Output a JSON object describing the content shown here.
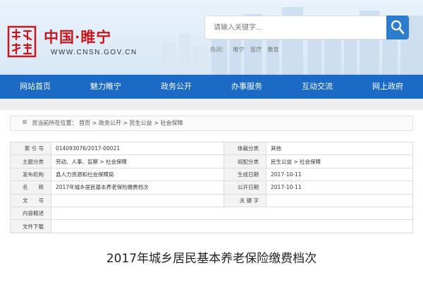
{
  "header": {
    "seal_text": "睢州宁陵",
    "site_name": "中国",
    "separator": "·",
    "site_name2": "睢宁",
    "domain": "WWW.CNSN.GOV.CN"
  },
  "search": {
    "placeholder": "请输入关键字...",
    "icon": "search-icon",
    "hot_label": "热词：",
    "hot_words": [
      "睢宁",
      "医疗",
      "教育"
    ]
  },
  "nav": {
    "items": [
      "网站首页",
      "魅力睢宁",
      "政务公开",
      "办事服务",
      "互动交流",
      "网上政府"
    ]
  },
  "breadcrumb": {
    "prefix": "您当前所在位置：",
    "path": [
      "首页",
      "政务公开",
      "民生公益",
      "社会保障"
    ],
    "sep": ">"
  },
  "info": {
    "rows": [
      {
        "l1": "索 引 号",
        "v1": "014093076/2017-00021",
        "l2": "体裁分类",
        "v2": "其他"
      },
      {
        "l1": "主题分类",
        "v1": "劳动、人事、监察 > 社会保障",
        "l2": "组配分类",
        "v2": "民生公益 > 社会保障"
      },
      {
        "l1": "发布机构",
        "v1": "县人力资源和社会保障局",
        "l2": "生成日期",
        "v2": "2017-10-11"
      },
      {
        "l1": "名　　称",
        "v1": "2017年城乡居民基本养老保险缴费档次",
        "l2": "公开日期",
        "v2": "2017-10-11"
      },
      {
        "l1": "文　　号",
        "v1": "",
        "l2": "关 键 字",
        "v2": ""
      }
    ],
    "summary_label": "内容概述",
    "summary_value": "",
    "download_label": "文件下载",
    "download_value": ""
  },
  "article": {
    "title": "2017年城乡居民基本养老保险缴费档次"
  },
  "colors": {
    "nav_bg": "#1a6ac6",
    "search_btn": "#2d7dcc",
    "brand_red": "#c8161d"
  }
}
